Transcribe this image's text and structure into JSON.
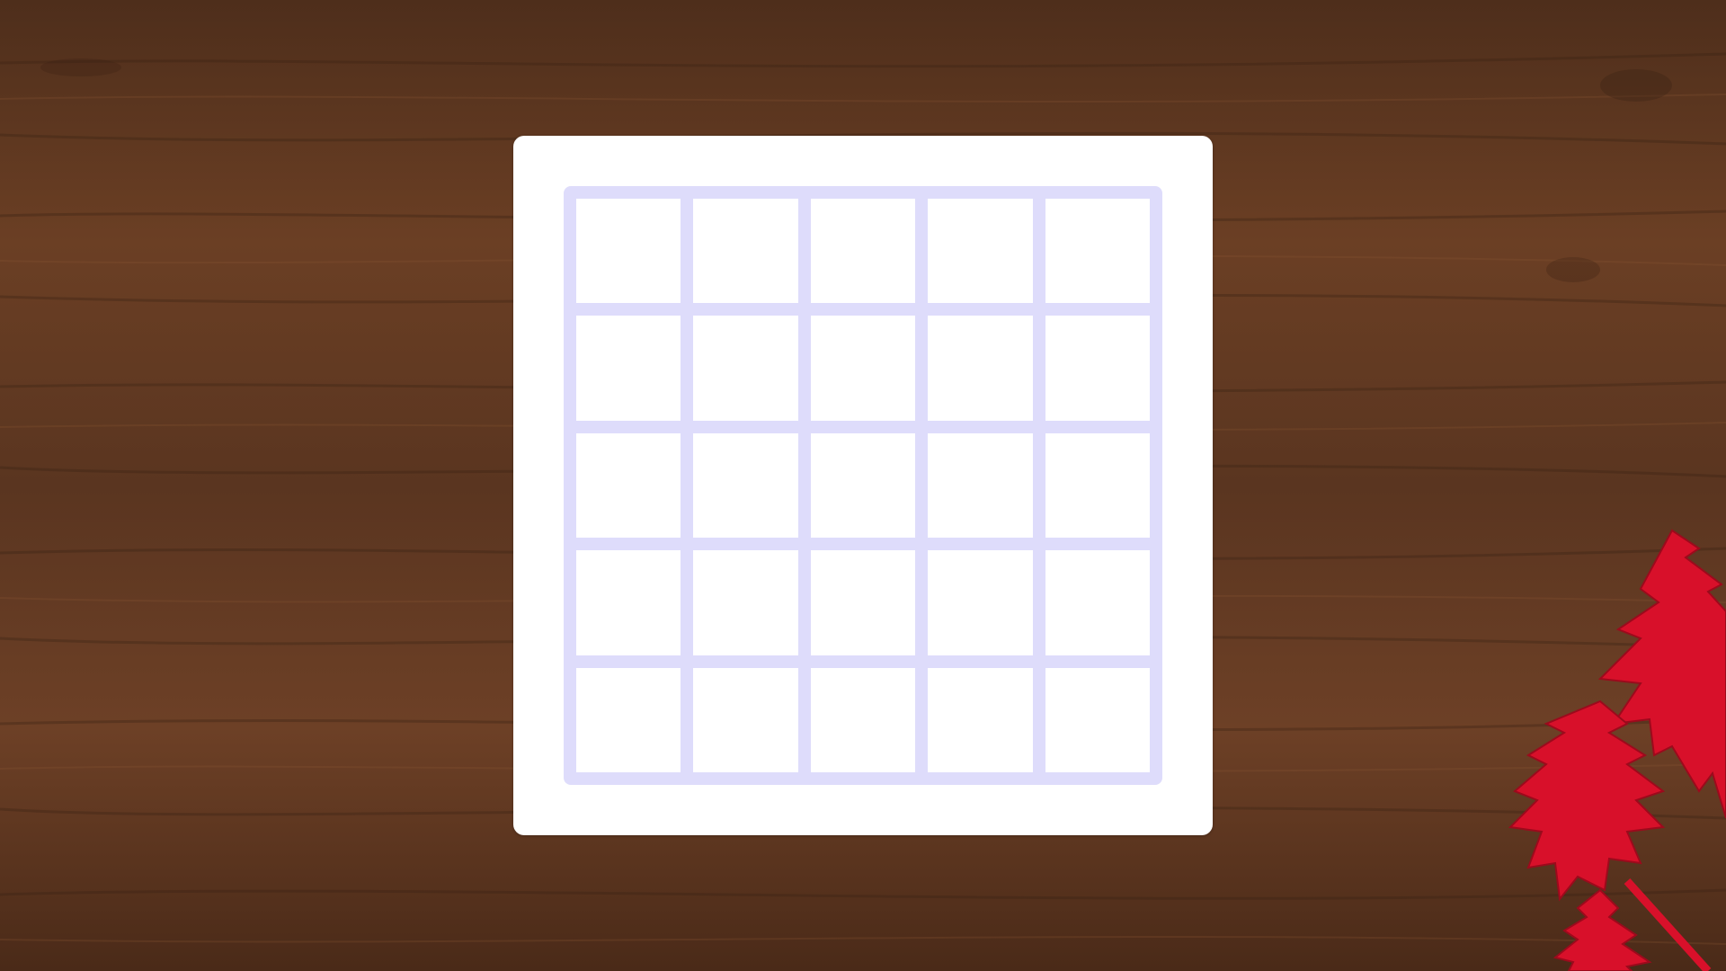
{
  "board": {
    "rows": 5,
    "columns": 5,
    "cells": [
      [
        "",
        "",
        "",
        "",
        ""
      ],
      [
        "",
        "",
        "",
        "",
        ""
      ],
      [
        "",
        "",
        "",
        "",
        ""
      ],
      [
        "",
        "",
        "",
        "",
        ""
      ],
      [
        "",
        "",
        "",
        "",
        ""
      ]
    ]
  },
  "colors": {
    "grid_line": "#dedcfb",
    "cell_fill": "#ffffff",
    "card_fill": "#ffffff",
    "tree_red": "#d8102a"
  },
  "icons": {
    "decoration": "red-christmas-tree-icon"
  }
}
